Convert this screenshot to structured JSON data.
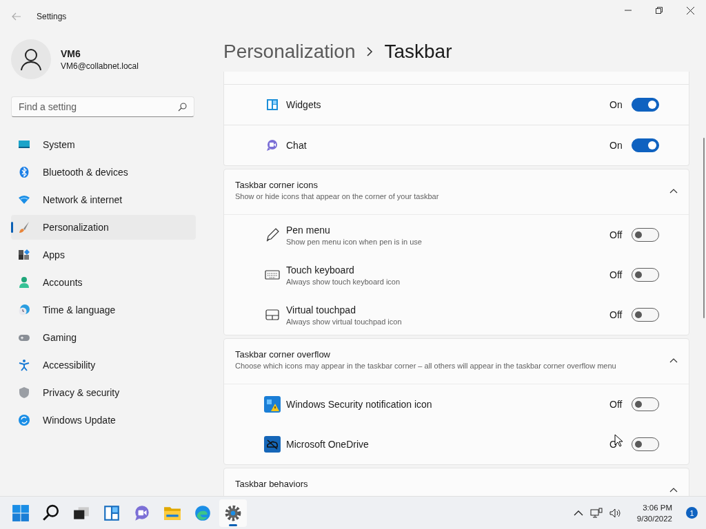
{
  "window": {
    "title": "Settings"
  },
  "account": {
    "name": "VM6",
    "email": "VM6@collabnet.local"
  },
  "search": {
    "placeholder": "Find a setting"
  },
  "nav": [
    {
      "label": "System",
      "selected": false
    },
    {
      "label": "Bluetooth & devices",
      "selected": false
    },
    {
      "label": "Network & internet",
      "selected": false
    },
    {
      "label": "Personalization",
      "selected": true
    },
    {
      "label": "Apps",
      "selected": false
    },
    {
      "label": "Accounts",
      "selected": false
    },
    {
      "label": "Time & language",
      "selected": false
    },
    {
      "label": "Gaming",
      "selected": false
    },
    {
      "label": "Accessibility",
      "selected": false
    },
    {
      "label": "Privacy & security",
      "selected": false
    },
    {
      "label": "Windows Update",
      "selected": false
    }
  ],
  "breadcrumb": {
    "parent": "Personalization",
    "current": "Taskbar"
  },
  "sections": [
    {
      "items": [
        {
          "label": "Widgets",
          "state": "On",
          "on": true
        },
        {
          "label": "Chat",
          "state": "On",
          "on": true
        }
      ]
    },
    {
      "title": "Taskbar corner icons",
      "description": "Show or hide icons that appear on the corner of your taskbar",
      "expanded": true,
      "items": [
        {
          "label": "Pen menu",
          "description": "Show pen menu icon when pen is in use",
          "state": "Off",
          "on": false
        },
        {
          "label": "Touch keyboard",
          "description": "Always show touch keyboard icon",
          "state": "Off",
          "on": false
        },
        {
          "label": "Virtual touchpad",
          "description": "Always show virtual touchpad icon",
          "state": "Off",
          "on": false
        }
      ]
    },
    {
      "title": "Taskbar corner overflow",
      "description": "Choose which icons may appear in the taskbar corner – all others will appear in the taskbar corner overflow menu",
      "expanded": true,
      "items": [
        {
          "label": "Windows Security notification icon",
          "state": "Off",
          "on": false
        },
        {
          "label": "Microsoft OneDrive",
          "state": "O",
          "on": false
        }
      ]
    },
    {
      "title": "Taskbar behaviors",
      "expanded": true
    }
  ],
  "taskbar": {
    "apps": [
      {
        "active": false
      },
      {
        "active": false
      },
      {
        "active": false
      },
      {
        "active": false
      },
      {
        "active": false
      },
      {
        "active": false
      },
      {
        "active": false
      },
      {
        "active": true
      }
    ],
    "time": "3:06 PM",
    "date": "9/30/2022",
    "notifications": "1"
  }
}
